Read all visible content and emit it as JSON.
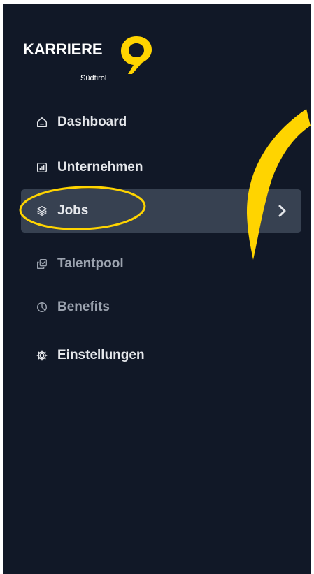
{
  "logo": {
    "wordmark": "KARRIERE",
    "subtitle": "Südtirol",
    "accent": "#FFD400"
  },
  "colors": {
    "sidebar_bg": "#111827",
    "active_bg": "#374151",
    "annotation": "#FFD400"
  },
  "nav": {
    "items": [
      {
        "label": "Dashboard",
        "icon": "home-icon",
        "active": false
      },
      {
        "label": "Unternehmen",
        "icon": "chart-box-icon",
        "active": false
      },
      {
        "label": "Jobs",
        "icon": "layers-icon",
        "active": true
      },
      {
        "label": "Talentpool",
        "icon": "copy-check-icon",
        "active": false
      },
      {
        "label": "Benefits",
        "icon": "pie-chart-icon",
        "active": false
      },
      {
        "label": "Einstellungen",
        "icon": "gear-icon",
        "active": false
      }
    ]
  }
}
